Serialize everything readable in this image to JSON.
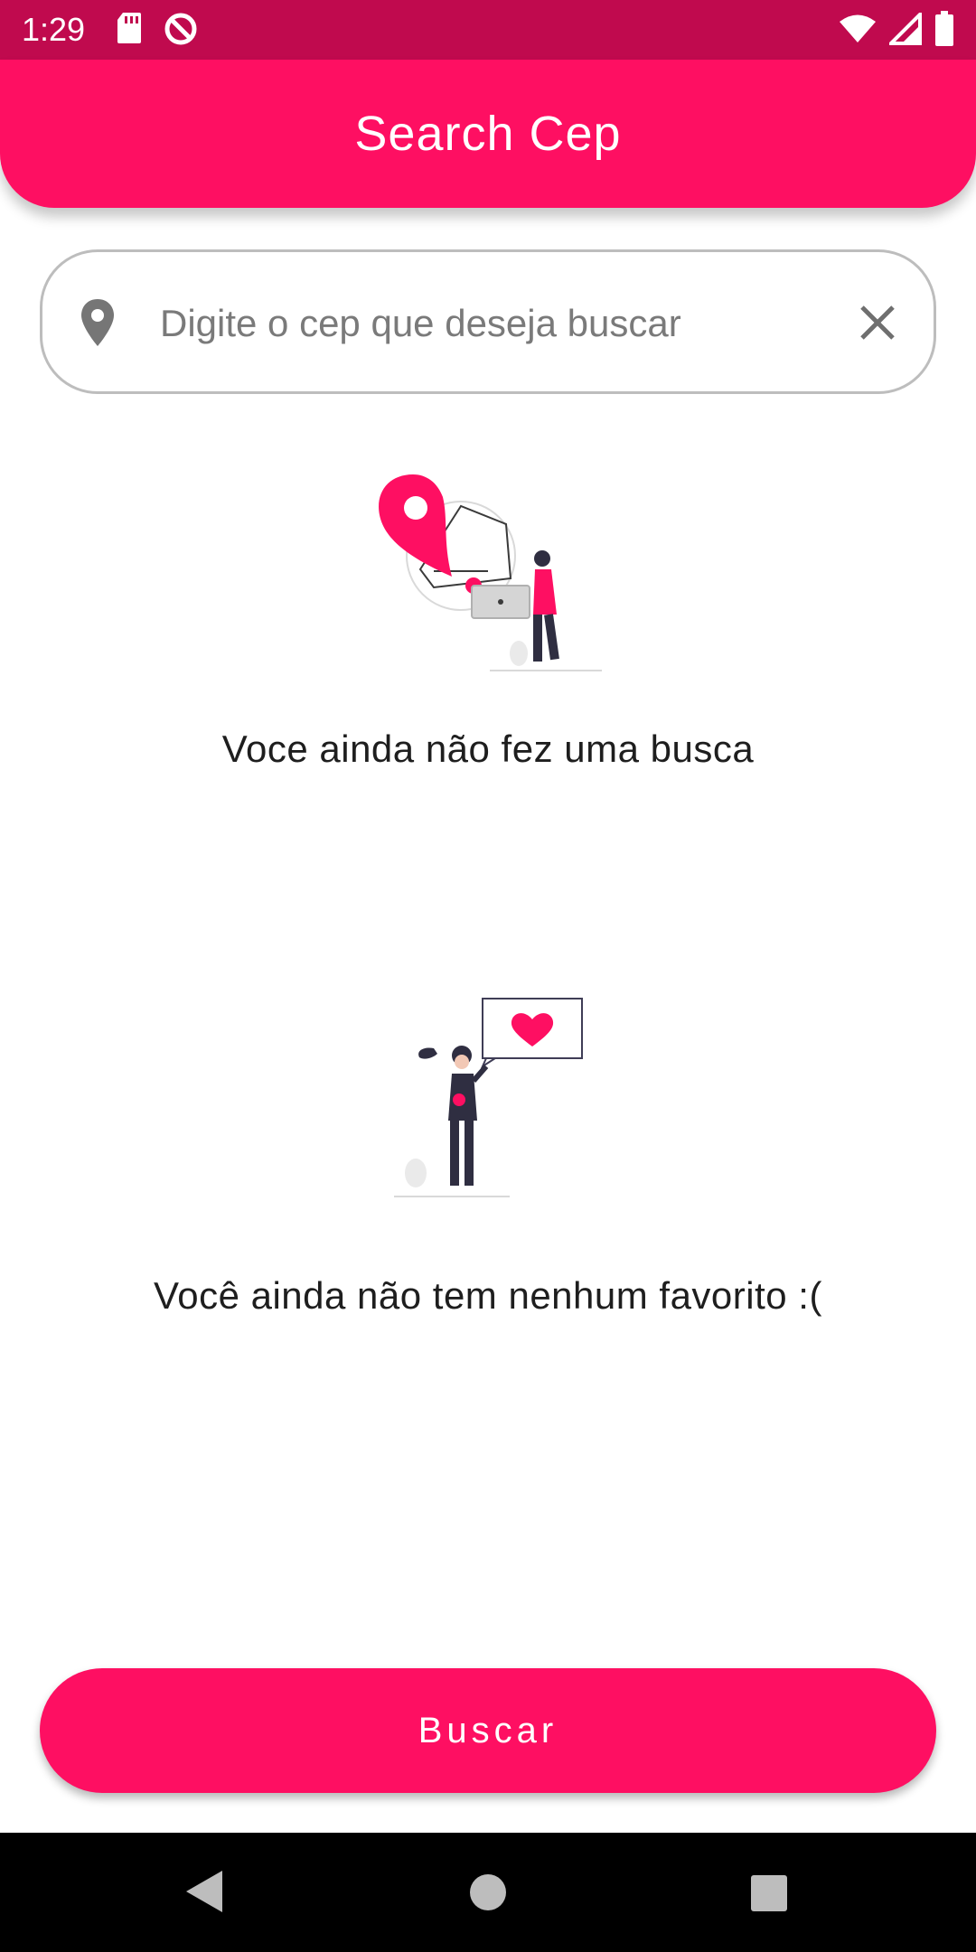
{
  "status_bar": {
    "time": "1:29",
    "icons": [
      "sd-card-icon",
      "data-saver-icon",
      "wifi-icon",
      "signal-icon",
      "battery-icon"
    ]
  },
  "app_bar": {
    "title": "Search Cep"
  },
  "search": {
    "placeholder": "Digite o cep que deseja buscar",
    "value": "",
    "leading_icon": "location-pin-icon",
    "trailing_icon": "close-icon"
  },
  "empty_states": {
    "search_message": "Voce ainda não fez uma busca",
    "favorites_message": "Você ainda não tem nenhum favorito :("
  },
  "actions": {
    "search_button": "Buscar"
  },
  "nav_bar": {
    "icons": [
      "back-icon",
      "home-icon",
      "recents-icon"
    ]
  },
  "colors": {
    "primary": "#fe0f62",
    "status_bar": "#c00a4e",
    "background": "#ffffff"
  }
}
